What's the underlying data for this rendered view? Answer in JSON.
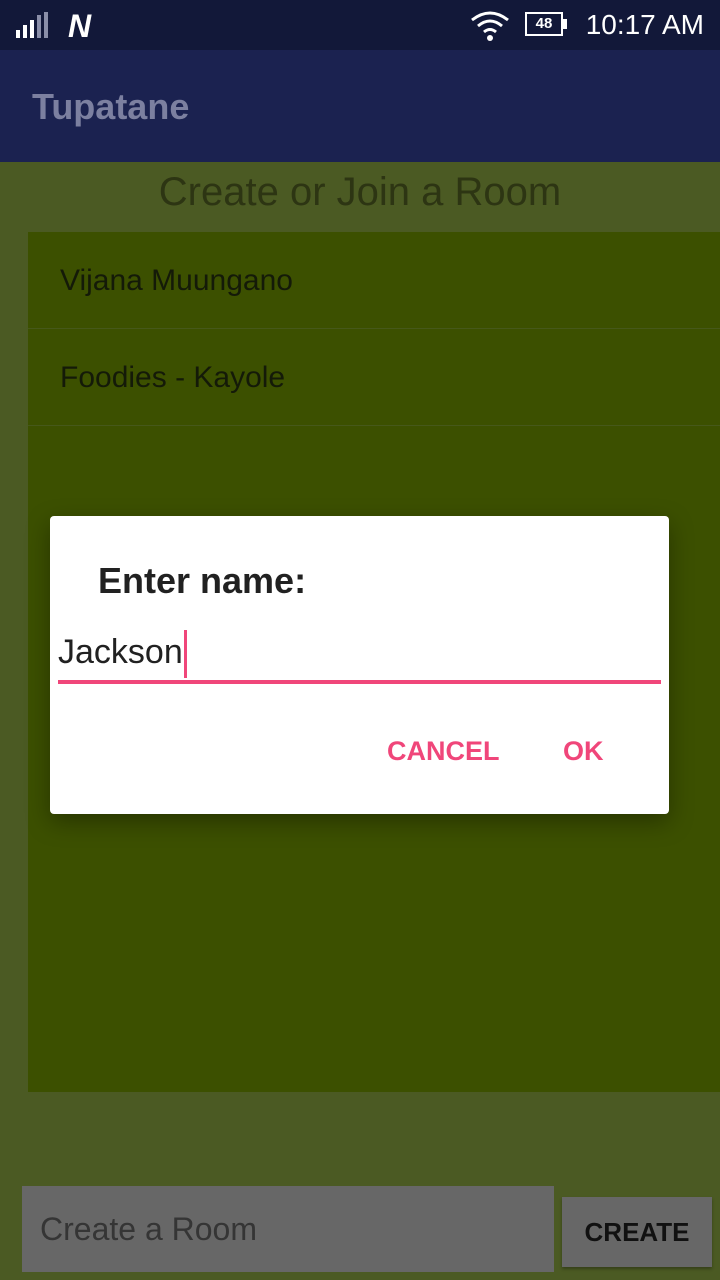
{
  "status_bar": {
    "battery": "48",
    "time": "10:17 AM",
    "icons": [
      "signal-icon",
      "n-notification-icon",
      "wifi-icon",
      "battery-icon"
    ]
  },
  "app_bar": {
    "title": "Tupatane"
  },
  "main": {
    "heading": "Create or Join a Room",
    "rooms": [
      {
        "name": "Vijana Muungano"
      },
      {
        "name": "Foodies - Kayole"
      }
    ],
    "create_input_placeholder": "Create a Room",
    "create_button": "CREATE"
  },
  "dialog": {
    "title": "Enter name:",
    "input_value": "Jackson",
    "cancel_label": "CANCEL",
    "ok_label": "OK"
  },
  "colors": {
    "status_bar": "#121839",
    "app_bar": "#1b2250",
    "background": "#4b5a23",
    "list_background": "#3c5000",
    "accent": "#f0467a"
  }
}
